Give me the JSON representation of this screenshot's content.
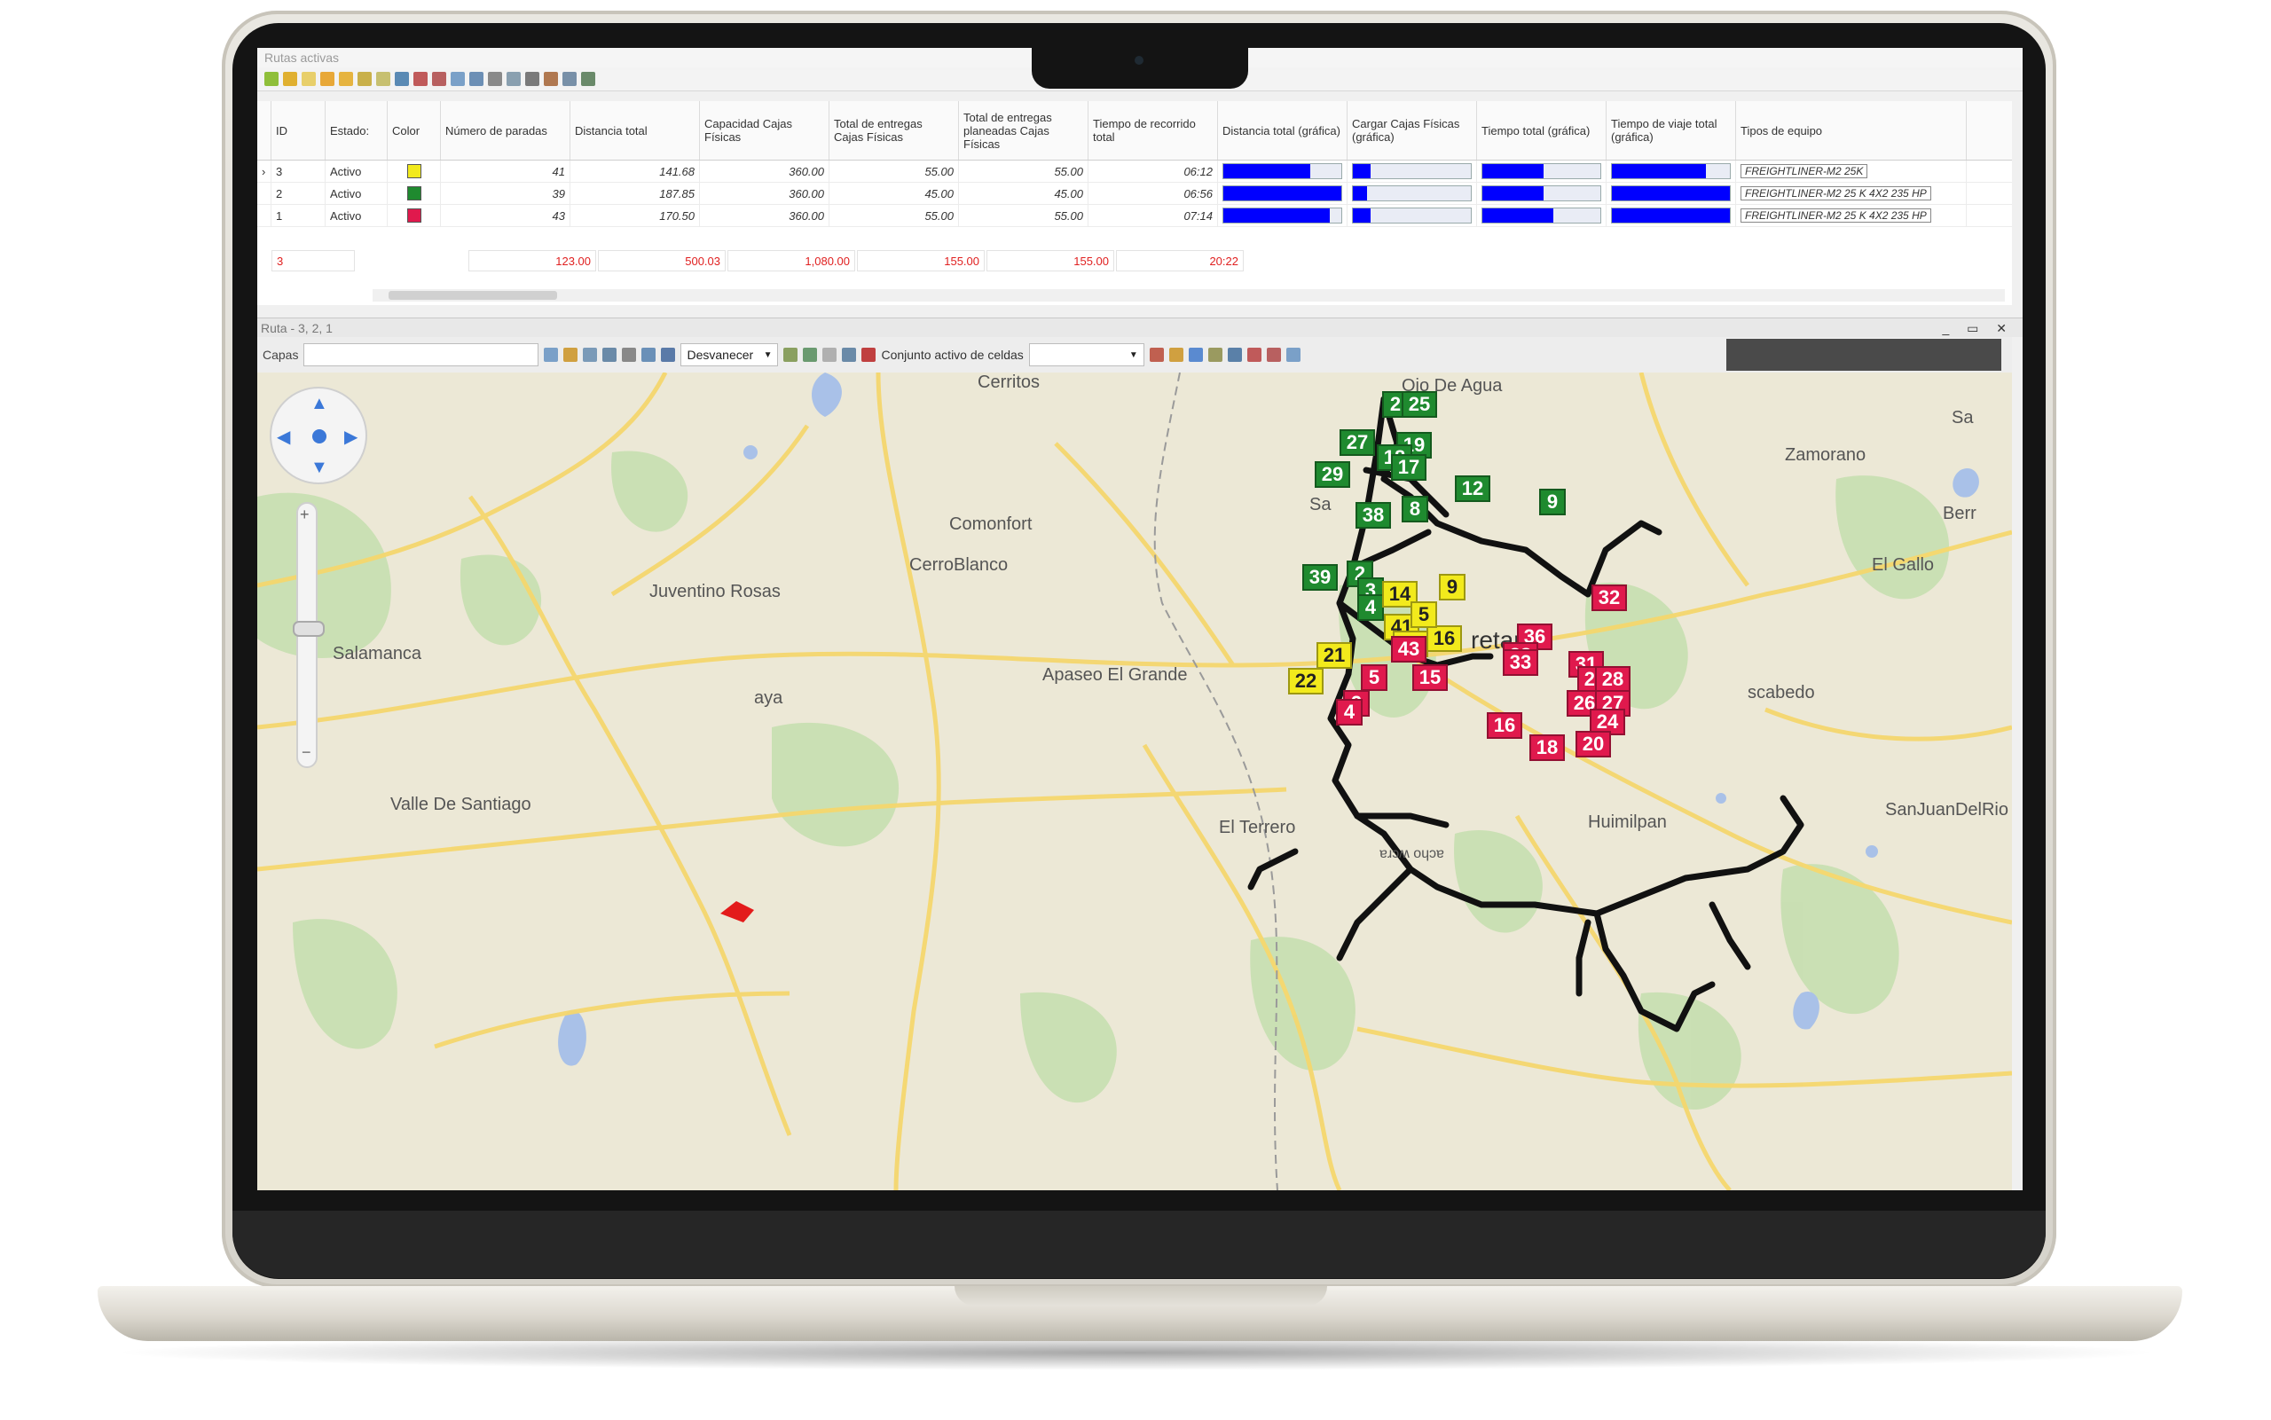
{
  "grid_panel": {
    "title": "Rutas activas",
    "columns": [
      "ID",
      "Estado:",
      "Color",
      "Número de paradas",
      "Distancia total",
      "Capacidad Cajas Físicas",
      "Total de entregas Cajas Físicas",
      "Total de entregas planeadas Cajas Físicas",
      "Tiempo de recorrido total",
      "Distancia total (gráfica)",
      "Cargar Cajas Físicas (gráfica)",
      "Tiempo total (gráfica)",
      "Tiempo de viaje total (gráfica)",
      "Tipos de equipo"
    ],
    "rows": [
      {
        "id": "3",
        "estado": "Activo",
        "color": "#f2ea1c",
        "paradas": "41",
        "distancia": "141.68",
        "capacidad": "360.00",
        "entregas": "55.00",
        "planeadas": "55.00",
        "tiempo": "06:12",
        "bar_dist": 0.74,
        "bar_carga": 0.15,
        "bar_tiempo": 0.52,
        "bar_viaje": 0.8,
        "equipo": "FREIGHTLINER-M2 25K"
      },
      {
        "id": "2",
        "estado": "Activo",
        "color": "#1f8a2f",
        "paradas": "39",
        "distancia": "187.85",
        "capacidad": "360.00",
        "entregas": "45.00",
        "planeadas": "45.00",
        "tiempo": "06:56",
        "bar_dist": 1.0,
        "bar_carga": 0.12,
        "bar_tiempo": 0.52,
        "bar_viaje": 1.0,
        "equipo": "FREIGHTLINER-M2 25 K 4X2 235 HP"
      },
      {
        "id": "1",
        "estado": "Activo",
        "color": "#e0194d",
        "paradas": "43",
        "distancia": "170.50",
        "capacidad": "360.00",
        "entregas": "55.00",
        "planeadas": "55.00",
        "tiempo": "07:14",
        "bar_dist": 0.9,
        "bar_carga": 0.15,
        "bar_tiempo": 0.6,
        "bar_viaje": 1.0,
        "equipo": "FREIGHTLINER-M2 25 K 4X2 235 HP"
      }
    ],
    "totals": {
      "id": "3",
      "paradas": "123.00",
      "distancia": "500.03",
      "capacidad": "1,080.00",
      "entregas": "155.00",
      "planeadas": "155.00",
      "tiempo": "20:22"
    }
  },
  "route_panel": {
    "title": "Ruta - 3, 2, 1",
    "window_buttons": "_ ▭ ✕",
    "layers_label": "Capas",
    "fade_select": "Desvanecer",
    "cells_label": "Conjunto activo de celdas"
  },
  "map": {
    "places": {
      "cerritos": "Cerritos",
      "ojo_de_agua": "Ojo De Agua",
      "comonfort": "Comonfort",
      "cerro_blanco": "CerroBlanco",
      "juventino": "Juventino Rosas",
      "salamanca": "Salamanca",
      "apaseo": "Apaseo El Grande",
      "celaya": "aya",
      "zamorano": "Zamorano",
      "el_gallo": "El Gallo",
      "berr": "Berr",
      "sa": "Sa",
      "escobedo": "scabedo",
      "queretaro": "retaro",
      "huimilpan": "Huimilpan",
      "el_terrero": "El Terrero",
      "valle": "Valle De Santiago",
      "san_juan": "SanJuanDelRio",
      "santa": "Sa",
      "bottom_tag": "ɐɹɔʍ oɥɔɐ"
    },
    "route_colors": {
      "green": "#1f8a2f",
      "yellow": "#f2ea1c",
      "red": "#e0194d",
      "line": "#111111"
    },
    "green_markers": [
      "2",
      "25",
      "27",
      "19",
      "18",
      "17",
      "29",
      "12",
      "9",
      "8",
      "38",
      "39",
      "2",
      "3",
      "4"
    ],
    "yellow_markers": [
      "14",
      "9",
      "41",
      "43",
      "16",
      "21",
      "22",
      "5"
    ],
    "red_markers": [
      "32",
      "36",
      "38",
      "33",
      "31",
      "29",
      "28",
      "26",
      "27",
      "24",
      "20",
      "18",
      "16",
      "43",
      "5",
      "15",
      "2",
      "4"
    ]
  }
}
